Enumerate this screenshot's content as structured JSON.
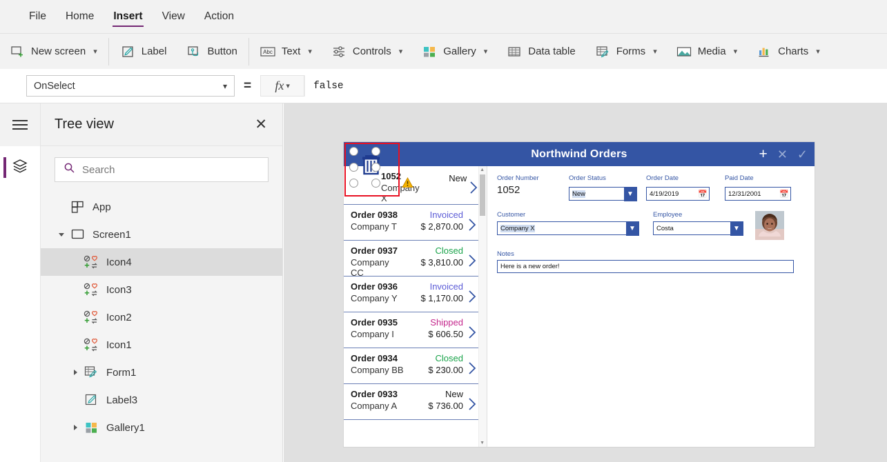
{
  "menu": {
    "items": [
      {
        "label": "File",
        "active": false
      },
      {
        "label": "Home",
        "active": false
      },
      {
        "label": "Insert",
        "active": true
      },
      {
        "label": "View",
        "active": false
      },
      {
        "label": "Action",
        "active": false
      }
    ]
  },
  "ribbon": {
    "groups": [
      {
        "items": [
          {
            "label": "New screen",
            "icon": "new-screen-icon",
            "chevron": true
          }
        ]
      },
      {
        "items": [
          {
            "label": "Label",
            "icon": "label-icon",
            "chevron": false
          },
          {
            "label": "Button",
            "icon": "button-icon",
            "chevron": false
          }
        ]
      },
      {
        "items": [
          {
            "label": "Text",
            "icon": "text-abc-icon",
            "chevron": true
          },
          {
            "label": "Controls",
            "icon": "controls-sliders-icon",
            "chevron": true
          },
          {
            "label": "Gallery",
            "icon": "gallery-grid-icon",
            "chevron": true
          },
          {
            "label": "Data table",
            "icon": "data-table-icon",
            "chevron": false
          },
          {
            "label": "Forms",
            "icon": "forms-icon",
            "chevron": true
          },
          {
            "label": "Media",
            "icon": "media-image-icon",
            "chevron": true
          },
          {
            "label": "Charts",
            "icon": "charts-bar-icon",
            "chevron": true
          }
        ]
      }
    ]
  },
  "formula_bar": {
    "property": "OnSelect",
    "equals": "=",
    "fx_label": "fx",
    "formula": "false"
  },
  "tree_view": {
    "title": "Tree view",
    "close_label": "✕",
    "search_placeholder": "Search",
    "search_value": "",
    "items": [
      {
        "label": "App",
        "icon": "app-icon",
        "indent": 1,
        "twisty": "none",
        "selected": false
      },
      {
        "label": "Screen1",
        "icon": "screen-icon",
        "indent": 1,
        "twisty": "expanded",
        "selected": false
      },
      {
        "label": "Icon4",
        "icon": "control-icon",
        "indent": 2,
        "twisty": "none",
        "selected": true
      },
      {
        "label": "Icon3",
        "icon": "control-icon",
        "indent": 2,
        "twisty": "none",
        "selected": false
      },
      {
        "label": "Icon2",
        "icon": "control-icon",
        "indent": 2,
        "twisty": "none",
        "selected": false
      },
      {
        "label": "Icon1",
        "icon": "control-icon",
        "indent": 2,
        "twisty": "none",
        "selected": false
      },
      {
        "label": "Form1",
        "icon": "forms-icon",
        "indent": 2,
        "twisty": "collapsed",
        "selected": false
      },
      {
        "label": "Label3",
        "icon": "label-icon",
        "indent": 2,
        "twisty": "none",
        "selected": false
      },
      {
        "label": "Gallery1",
        "icon": "gallery-grid-icon",
        "indent": 2,
        "twisty": "collapsed",
        "selected": false
      }
    ]
  },
  "app_preview": {
    "header": {
      "title": "Northwind Orders",
      "actions": [
        {
          "name": "add-icon",
          "glyph": "+",
          "dim": false
        },
        {
          "name": "cancel-icon",
          "glyph": "✕",
          "dim": true
        },
        {
          "name": "check-icon",
          "glyph": "✓",
          "dim": true
        }
      ]
    },
    "gallery": {
      "rows": [
        {
          "order": "1052",
          "company": "Company X",
          "status": "New",
          "amount": "",
          "status_color": "#1a1a1a",
          "selected": true,
          "warning": true
        },
        {
          "order": "Order 0938",
          "company": "Company T",
          "status": "Invoiced",
          "amount": "$ 2,870.00",
          "status_color": "#5b5bd6",
          "selected": false,
          "warning": false
        },
        {
          "order": "Order 0937",
          "company": "Company CC",
          "status": "Closed",
          "amount": "$ 3,810.00",
          "status_color": "#1aa34a",
          "selected": false,
          "warning": false
        },
        {
          "order": "Order 0936",
          "company": "Company Y",
          "status": "Invoiced",
          "amount": "$ 1,170.00",
          "status_color": "#5b5bd6",
          "selected": false,
          "warning": false
        },
        {
          "order": "Order 0935",
          "company": "Company I",
          "status": "Shipped",
          "amount": "$ 606.50",
          "status_color": "#c4268c",
          "selected": false,
          "warning": false
        },
        {
          "order": "Order 0934",
          "company": "Company BB",
          "status": "Closed",
          "amount": "$ 230.00",
          "status_color": "#1aa34a",
          "selected": false,
          "warning": false
        },
        {
          "order": "Order 0933",
          "company": "Company A",
          "status": "New",
          "amount": "$ 736.00",
          "status_color": "#1a1a1a",
          "selected": false,
          "warning": false
        }
      ]
    },
    "form": {
      "order_number": {
        "label": "Order Number",
        "value": "1052"
      },
      "order_status": {
        "label": "Order Status",
        "value": "New"
      },
      "order_date": {
        "label": "Order Date",
        "value": "4/19/2019"
      },
      "paid_date": {
        "label": "Paid Date",
        "value": "12/31/2001"
      },
      "customer": {
        "label": "Customer",
        "value": "Company X"
      },
      "employee": {
        "label": "Employee",
        "value": "Costa"
      },
      "notes": {
        "label": "Notes",
        "value": "Here is a new order!"
      }
    }
  },
  "colors": {
    "accent_purple": "#742774",
    "app_header_blue": "#3455a4",
    "selection_red": "#e81123",
    "status_invoiced": "#5b5bd6",
    "status_closed": "#1aa34a",
    "status_shipped": "#c4268c"
  }
}
